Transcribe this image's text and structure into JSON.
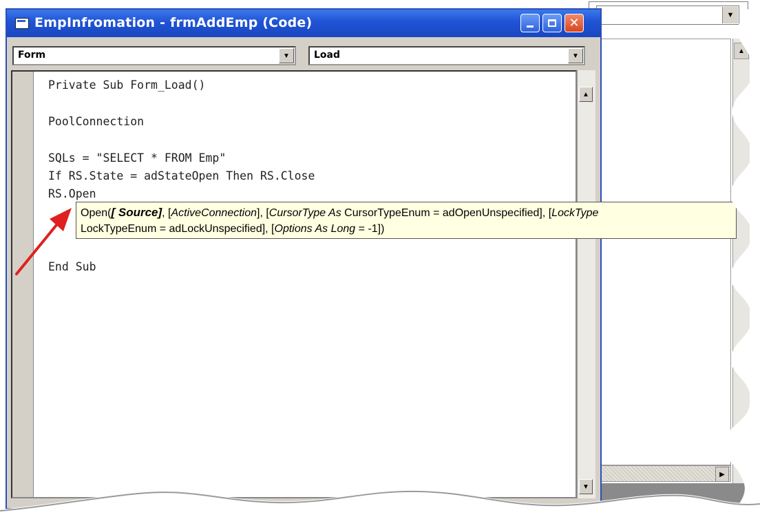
{
  "window": {
    "title": "EmpInfromation - frmAddEmp (Code)"
  },
  "combos": {
    "object_value": "Form",
    "procedure_value": "Load"
  },
  "code": {
    "lines": [
      "Private Sub Form_Load()",
      "PoolConnection",
      "SQLs = \"SELECT * FROM Emp\"",
      "If RS.State = adStateOpen Then RS.Close",
      "RS.Open",
      "End Sub"
    ]
  },
  "tooltip": {
    "l1_a": "Open(",
    "l1_b": "[ Source]",
    "l1_c": ", [",
    "l1_d": "ActiveConnection",
    "l1_e": "], [",
    "l1_f": "CursorType As",
    "l1_g": " CursorTypeEnum = adOpenUnspecified], [",
    "l1_h": "LockType",
    "l2_a": "LockTypeEnum = adLockUnspecified], [",
    "l2_b": "Options As Long",
    "l2_c": " = -1])"
  },
  "colors": {
    "title_bar": "#1f53d4",
    "tooltip_bg": "#ffffe1",
    "annotation_arrow": "#e02020"
  },
  "icons": [
    "window-icon",
    "minimize-icon",
    "maximize-icon",
    "close-icon",
    "dropdown-arrow-icon",
    "scroll-up-icon",
    "scroll-down-icon",
    "scroll-right-icon",
    "annotation-arrow-icon"
  ]
}
